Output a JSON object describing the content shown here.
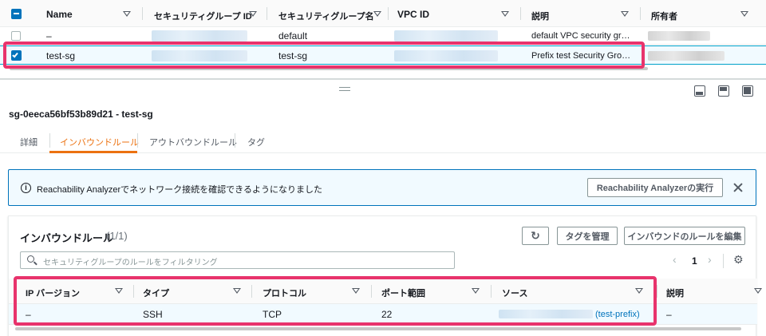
{
  "top_table": {
    "headers": [
      "Name",
      "セキュリティグループ ID",
      "セキュリティグループ名",
      "VPC ID",
      "説明",
      "所有者"
    ],
    "rows": [
      {
        "name": "–",
        "group_name": "default",
        "description": "default VPC security gr…",
        "selected": false
      },
      {
        "name": "test-sg",
        "group_name": "test-sg",
        "description": "Prefix test Security Gro…",
        "selected": true
      }
    ]
  },
  "panel_icons": [
    "panel-bottom-icon",
    "panel-split-icon",
    "panel-side-icon"
  ],
  "detail": {
    "title": "sg-0eeca56bf53b89d21 - test-sg",
    "tabs": [
      "詳細",
      "インバウンドルール",
      "アウトバウンドルール",
      "タグ"
    ],
    "active_tab": 1
  },
  "info_banner": {
    "text": "Reachability Analyzerでネットワーク接続を確認できるようになりました",
    "button": "Reachability Analyzerの実行"
  },
  "inbound": {
    "title": "インバウンドルール",
    "count": "(1/1)",
    "manage_tags": "タグを管理",
    "edit_rules": "インバウンドのルールを編集",
    "search_placeholder": "セキュリティグループのルールをフィルタリング",
    "page": "1",
    "headers": [
      "IP バージョン",
      "タイプ",
      "プロトコル",
      "ポート範囲",
      "ソース",
      "説明"
    ],
    "row": {
      "ip_version": "–",
      "type": "SSH",
      "protocol": "TCP",
      "port_range": "22",
      "source_suffix": "(test-prefix)",
      "description": "–"
    }
  },
  "colors": {
    "accent": "#ec7211",
    "link": "#0073bb",
    "highlight": "#e8336c",
    "selected_row": "#f1faff"
  }
}
